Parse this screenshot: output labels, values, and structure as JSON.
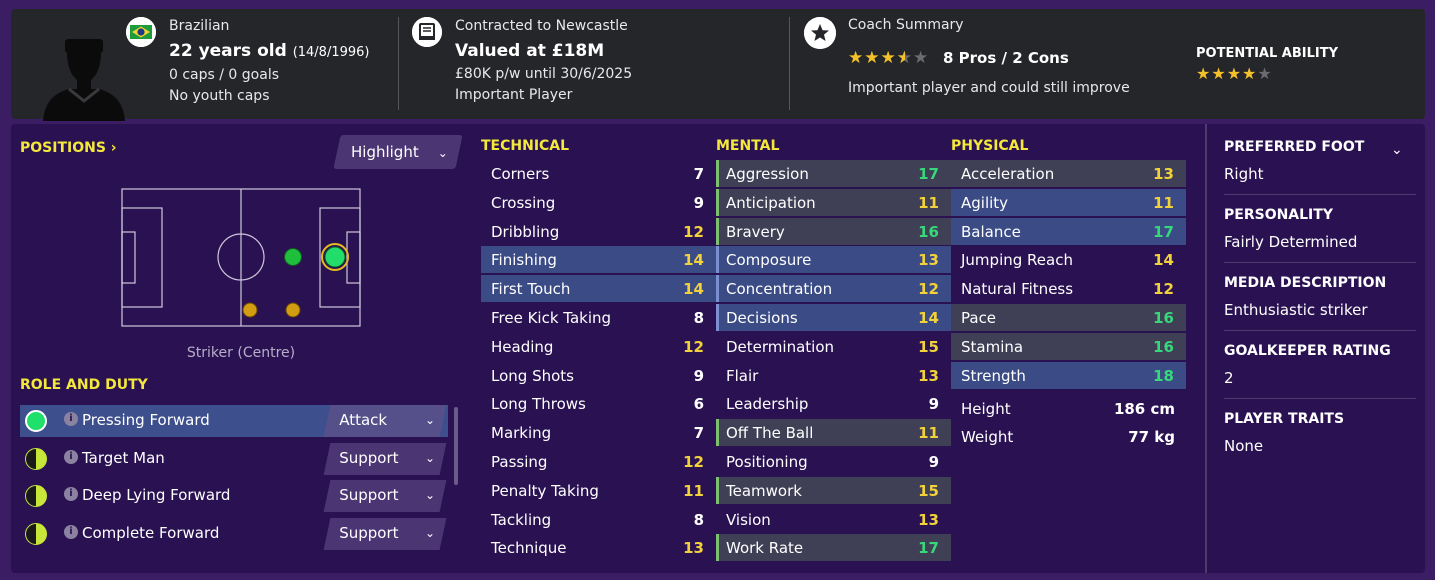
{
  "header": {
    "nationality": "Brazilian",
    "age": "22 years old",
    "dob": "(14/8/1996)",
    "caps": "0 caps / 0 goals",
    "youth_caps": "No youth caps",
    "contract_club": "Contracted to Newcastle",
    "value": "Valued at £18M",
    "wage": "£80K p/w until 30/6/2025",
    "squad_status": "Important Player",
    "coach_summary_title": "Coach Summary",
    "current_ability_stars": 3.5,
    "pros_cons": "8 Pros / 2 Cons",
    "coach_summary_text": "Important player and could still improve",
    "potential_title": "POTENTIAL ABILITY",
    "potential_ability_stars": 4
  },
  "positions": {
    "title": "POSITIONS",
    "highlight_label": "Highlight",
    "position_label": "Striker (Centre)"
  },
  "role_duty": {
    "title": "ROLE AND DUTY",
    "roles": [
      {
        "name": "Pressing Forward",
        "duty": "Attack",
        "suitability": "green"
      },
      {
        "name": "Target Man",
        "duty": "Support",
        "suitability": "half"
      },
      {
        "name": "Deep Lying Forward",
        "duty": "Support",
        "suitability": "half"
      },
      {
        "name": "Complete Forward",
        "duty": "Support",
        "suitability": "half"
      }
    ]
  },
  "technical": {
    "title": "TECHNICAL",
    "attrs": [
      {
        "name": "Corners",
        "value": "7"
      },
      {
        "name": "Crossing",
        "value": "9"
      },
      {
        "name": "Dribbling",
        "value": "12"
      },
      {
        "name": "Finishing",
        "value": "14"
      },
      {
        "name": "First Touch",
        "value": "14"
      },
      {
        "name": "Free Kick Taking",
        "value": "8"
      },
      {
        "name": "Heading",
        "value": "12"
      },
      {
        "name": "Long Shots",
        "value": "9"
      },
      {
        "name": "Long Throws",
        "value": "6"
      },
      {
        "name": "Marking",
        "value": "7"
      },
      {
        "name": "Passing",
        "value": "12"
      },
      {
        "name": "Penalty Taking",
        "value": "11"
      },
      {
        "name": "Tackling",
        "value": "8"
      },
      {
        "name": "Technique",
        "value": "13"
      }
    ]
  },
  "mental": {
    "title": "MENTAL",
    "attrs": [
      {
        "name": "Aggression",
        "value": "17"
      },
      {
        "name": "Anticipation",
        "value": "11"
      },
      {
        "name": "Bravery",
        "value": "16"
      },
      {
        "name": "Composure",
        "value": "13"
      },
      {
        "name": "Concentration",
        "value": "12"
      },
      {
        "name": "Decisions",
        "value": "14"
      },
      {
        "name": "Determination",
        "value": "15"
      },
      {
        "name": "Flair",
        "value": "13"
      },
      {
        "name": "Leadership",
        "value": "9"
      },
      {
        "name": "Off The Ball",
        "value": "11"
      },
      {
        "name": "Positioning",
        "value": "9"
      },
      {
        "name": "Teamwork",
        "value": "15"
      },
      {
        "name": "Vision",
        "value": "13"
      },
      {
        "name": "Work Rate",
        "value": "17"
      }
    ]
  },
  "physical": {
    "title": "PHYSICAL",
    "attrs": [
      {
        "name": "Acceleration",
        "value": "13"
      },
      {
        "name": "Agility",
        "value": "11"
      },
      {
        "name": "Balance",
        "value": "17"
      },
      {
        "name": "Jumping Reach",
        "value": "14"
      },
      {
        "name": "Natural Fitness",
        "value": "12"
      },
      {
        "name": "Pace",
        "value": "16"
      },
      {
        "name": "Stamina",
        "value": "16"
      },
      {
        "name": "Strength",
        "value": "18"
      }
    ],
    "height_label": "Height",
    "height": "186 cm",
    "weight_label": "Weight",
    "weight": "77 kg"
  },
  "info": {
    "preferred_foot_title": "PREFERRED FOOT",
    "preferred_foot": "Right",
    "personality_title": "PERSONALITY",
    "personality": "Fairly Determined",
    "media_title": "MEDIA DESCRIPTION",
    "media": "Enthusiastic striker",
    "gk_title": "GOALKEEPER RATING",
    "gk": "2",
    "traits_title": "PLAYER TRAITS",
    "traits": "None"
  },
  "colors": {
    "accent_yellow": "#f4e83b",
    "value_white": "#ffffff",
    "value_yellow": "#f1d23a",
    "value_green": "#37d87a",
    "role_green": "#1fe06a",
    "role_yellow": "#c8e63a"
  }
}
